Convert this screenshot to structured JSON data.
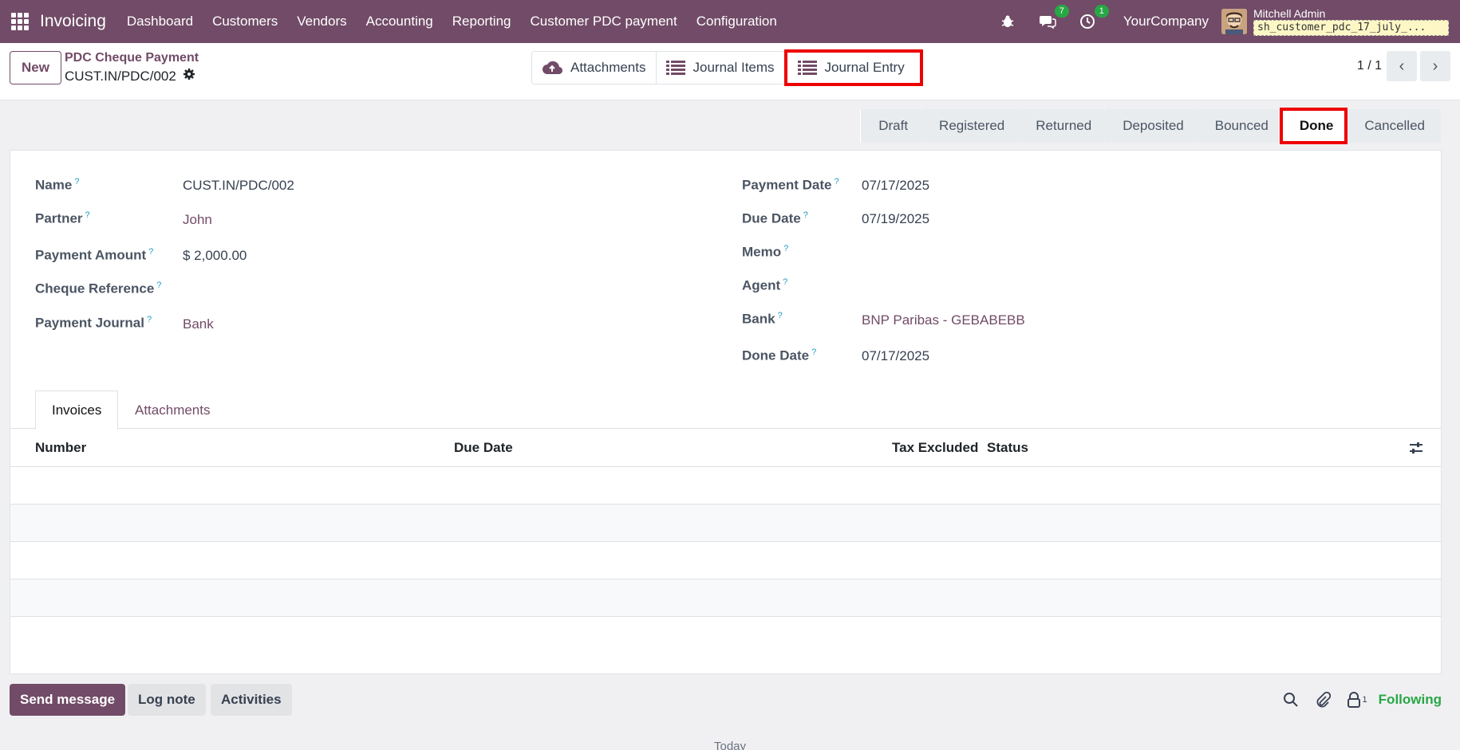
{
  "navbar": {
    "brand": "Invoicing",
    "menu": [
      "Dashboard",
      "Customers",
      "Vendors",
      "Accounting",
      "Reporting",
      "Customer PDC payment",
      "Configuration"
    ],
    "messages_count": "7",
    "activities_count": "1",
    "company": "YourCompany",
    "user_name": "Mitchell Admin",
    "db_name": "sh_customer_pdc_17_july_..."
  },
  "control": {
    "new_label": "New",
    "breadcrumb_parent": "PDC Cheque Payment",
    "breadcrumb_current": "CUST.IN/PDC/002",
    "smart_buttons": [
      "Attachments",
      "Journal Items",
      "Journal Entry"
    ],
    "pager": "1 / 1"
  },
  "status_stages": [
    "Draft",
    "Registered",
    "Returned",
    "Deposited",
    "Bounced",
    "Done",
    "Cancelled"
  ],
  "active_stage": "Done",
  "form": {
    "left": [
      {
        "label": "Name",
        "value": "CUST.IN/PDC/002"
      },
      {
        "label": "Partner",
        "value": "John"
      },
      {
        "label": "Payment Amount",
        "value": "$ 2,000.00"
      },
      {
        "label": "Cheque Reference",
        "value": ""
      },
      {
        "label": "Payment Journal",
        "value": "Bank"
      }
    ],
    "right": [
      {
        "label": "Payment Date",
        "value": "07/17/2025"
      },
      {
        "label": "Due Date",
        "value": "07/19/2025"
      },
      {
        "label": "Memo",
        "value": ""
      },
      {
        "label": "Agent",
        "value": ""
      },
      {
        "label": "Bank",
        "value": "BNP Paribas - GEBABEBB"
      },
      {
        "label": "Done Date",
        "value": "07/17/2025"
      }
    ],
    "help_mark": "?"
  },
  "tabs": [
    "Invoices",
    "Attachments"
  ],
  "table": {
    "columns": [
      "Number",
      "Due Date",
      "Tax Excluded",
      "Status"
    ]
  },
  "chatter": {
    "send_message": "Send message",
    "log_note": "Log note",
    "activities": "Activities",
    "followers_count": "1",
    "following": "Following"
  },
  "today_label": "Today"
}
